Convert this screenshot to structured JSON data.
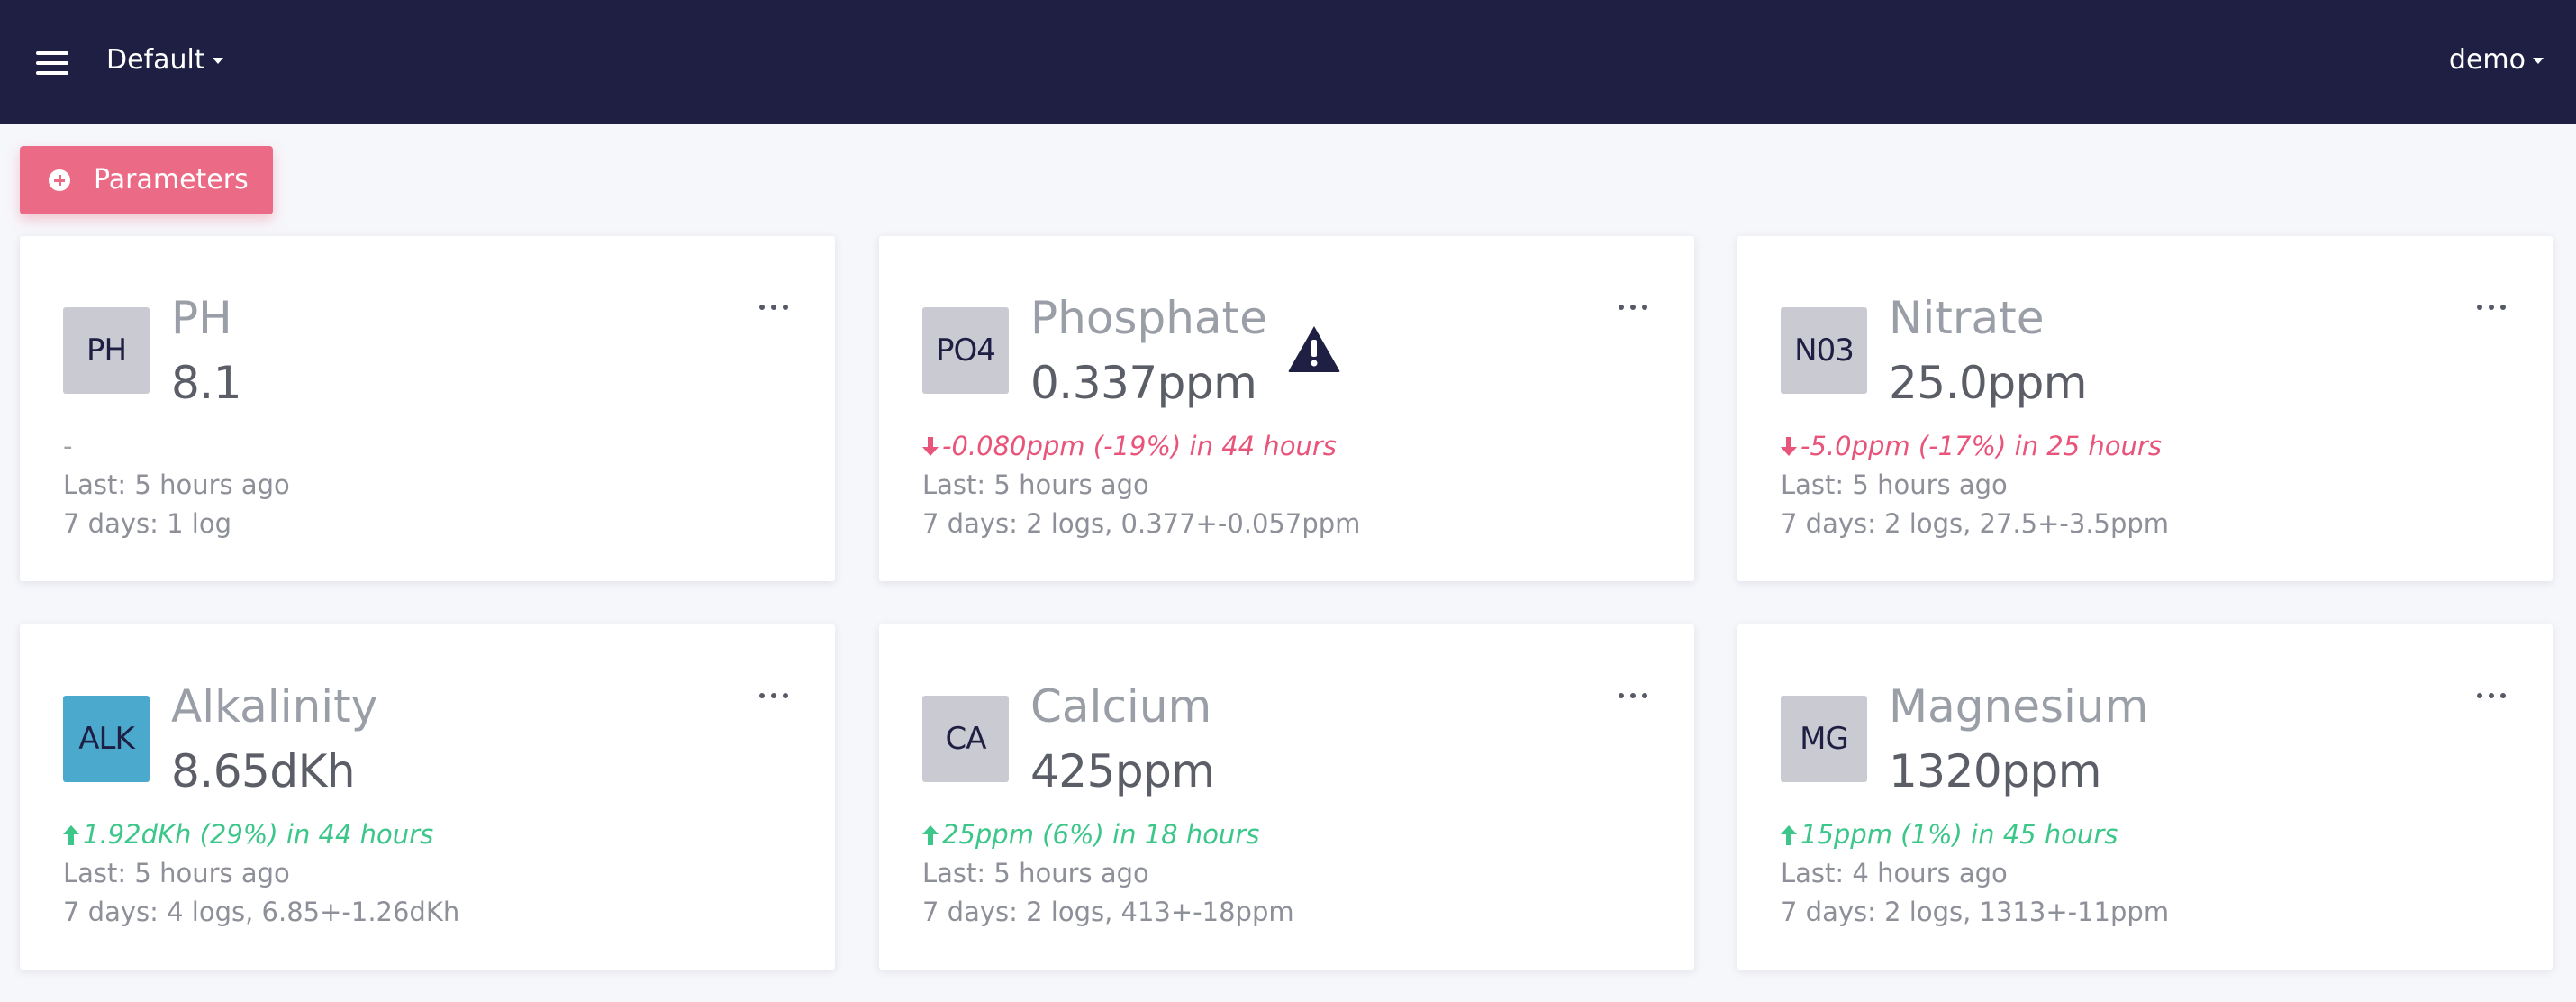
{
  "header": {
    "menu_icon": "hamburger-icon",
    "workspace": "Default",
    "user": "demo"
  },
  "toolbar": {
    "add_icon": "plus-circle-icon",
    "parameters_label": "Parameters"
  },
  "colors": {
    "topbar": "#1f1f44",
    "accent": "#eb6a85",
    "trend_down": "#e8547a",
    "trend_up": "#3cc68a",
    "alk_badge": "#4aa9cd",
    "default_badge": "#cacad2"
  },
  "cards": [
    {
      "badge": "PH",
      "name": "PH",
      "value": "8.1",
      "trend": "-",
      "last": "Last: 5 hours ago",
      "week": "7 days: 1 log"
    },
    {
      "badge": "PO4",
      "name": "Phosphate",
      "value": "0.337ppm",
      "warning_icon": "warning-triangle-icon",
      "trend": "-0.080ppm (-19%) in 44 hours",
      "trend_direction": "down",
      "last": "Last: 5 hours ago",
      "week": "7 days: 2 logs, 0.377+-0.057ppm"
    },
    {
      "badge": "N03",
      "name": "Nitrate",
      "value": "25.0ppm",
      "trend": "-5.0ppm (-17%) in 25 hours",
      "trend_direction": "down",
      "last": "Last: 5 hours ago",
      "week": "7 days: 2 logs, 27.5+-3.5ppm"
    },
    {
      "badge": "ALK",
      "name": "Alkalinity",
      "value": "8.65dKh",
      "trend": "1.92dKh (29%) in 44 hours",
      "trend_direction": "up",
      "last": "Last: 5 hours ago",
      "week": "7 days: 4 logs, 6.85+-1.26dKh"
    },
    {
      "badge": "CA",
      "name": "Calcium",
      "value": "425ppm",
      "trend": "25ppm (6%) in 18 hours",
      "trend_direction": "up",
      "last": "Last: 5 hours ago",
      "week": "7 days: 2 logs, 413+-18ppm"
    },
    {
      "badge": "MG",
      "name": "Magnesium",
      "value": "1320ppm",
      "trend": "15ppm (1%) in 45 hours",
      "trend_direction": "up",
      "last": "Last: 4 hours ago",
      "week": "7 days: 2 logs, 1313+-11ppm"
    }
  ]
}
